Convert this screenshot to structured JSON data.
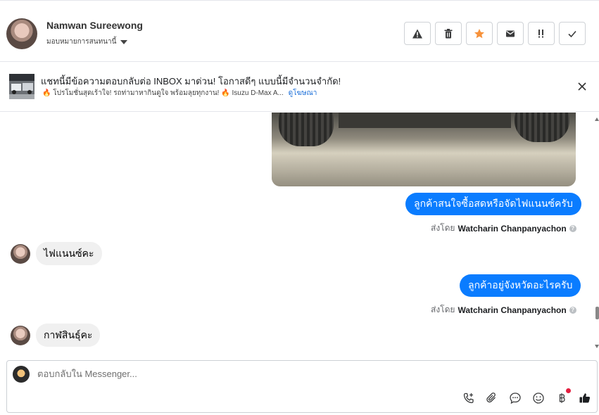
{
  "header": {
    "contact_name": "Namwan Sureewong",
    "assign_label": "มอบหมายการสนทนานี้",
    "actions": [
      "warning-icon",
      "trash-icon",
      "star-icon",
      "mail-icon",
      "important-icon",
      "check-icon"
    ],
    "star_color": "#f7923b"
  },
  "ad": {
    "title": "แชทนี้มีข้อความตอบกลับต่อ INBOX มาด่วน! โอกาสดีๆ แบบนี้มีจำนวนจำกัด!",
    "subtitle": "🔥 โปรโมชั่นสุดเร้าใจ! รถท่ามาหากินดูใจ พร้อมลุยทุกงาน! 🔥 Isuzu D-Max A...",
    "link": "ดูโฆษณา"
  },
  "messages": [
    {
      "type": "out",
      "text": "ลูกค้าสนใจซื้อสดหรือจัดไฟแนนซ์ครับ",
      "sent_by_prefix": "ส่งโดย",
      "sent_by": "Watcharin Chanpanyachon"
    },
    {
      "type": "in",
      "text": "ไฟแนนซ์คะ"
    },
    {
      "type": "out",
      "text": "ลูกค้าอยู่จังหวัดอะไรครับ",
      "sent_by_prefix": "ส่งโดย",
      "sent_by": "Watcharin Chanpanyachon"
    },
    {
      "type": "in",
      "text": "กาฬสินธุ์คะ"
    }
  ],
  "composer": {
    "placeholder": "ตอบกลับใน Messenger...",
    "tools": [
      "call-add-icon",
      "attachment-icon",
      "chat-bubble-icon",
      "emoji-icon",
      "baht-icon",
      "thumbs-up-icon"
    ]
  },
  "colors": {
    "accent": "#0a7cff",
    "incoming_bg": "#f0f0f0",
    "badge_red": "#e41e3f"
  }
}
